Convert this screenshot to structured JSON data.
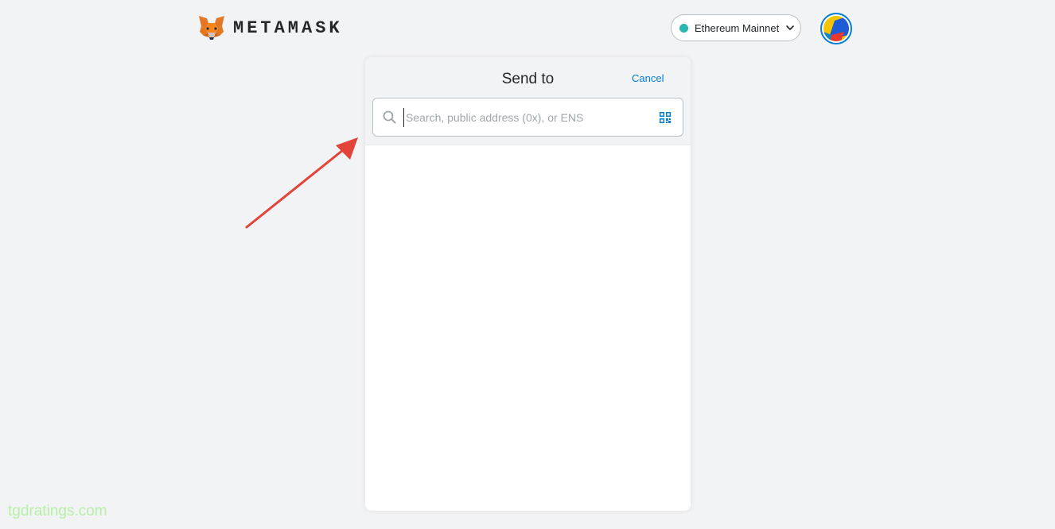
{
  "header": {
    "logo_text": "METAMASK",
    "network": {
      "label": "Ethereum Mainnet",
      "status_color": "#29b6af"
    }
  },
  "send": {
    "title": "Send to",
    "cancel_label": "Cancel",
    "search": {
      "placeholder": "Search, public address (0x), or ENS",
      "value": ""
    }
  },
  "annotation": {
    "arrow_color": "#e3443a"
  },
  "watermark": "tgdratings.com",
  "colors": {
    "accent": "#037dd6",
    "background": "#f2f3f4"
  },
  "icons": {
    "logo": "metamask-fox-icon",
    "network_toggle": "chevron-down-icon",
    "account": "account-avatar",
    "search": "search-icon",
    "qr": "qr-code-icon"
  }
}
